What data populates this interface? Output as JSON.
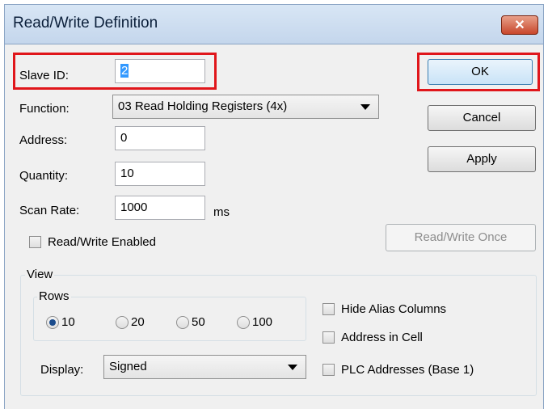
{
  "window": {
    "title": "Read/Write Definition",
    "close_glyph": "✕"
  },
  "form": {
    "slave_id_label": "Slave ID:",
    "slave_id_value": "2",
    "function_label": "Function:",
    "function_value": "03 Read Holding Registers (4x)",
    "address_label": "Address:",
    "address_value": "0",
    "quantity_label": "Quantity:",
    "quantity_value": "10",
    "scan_rate_label": "Scan Rate:",
    "scan_rate_value": "1000",
    "scan_rate_unit": "ms",
    "rw_enabled_label": "Read/Write Enabled",
    "rw_enabled_checked": false
  },
  "buttons": {
    "ok": "OK",
    "cancel": "Cancel",
    "apply": "Apply",
    "rw_once": "Read/Write Once"
  },
  "view": {
    "group_label": "View",
    "rows_label": "Rows",
    "row_options": [
      "10",
      "20",
      "50",
      "100"
    ],
    "row_selected": "10",
    "display_label": "Display:",
    "display_value": "Signed",
    "hide_alias_label": "Hide Alias Columns",
    "address_in_cell_label": "Address in Cell",
    "plc_addresses_label": "PLC Addresses (Base 1)"
  },
  "colors": {
    "highlight": "#e0161b",
    "titlebar": "#c9daf0",
    "ok_focus": "#3c7fb1"
  }
}
